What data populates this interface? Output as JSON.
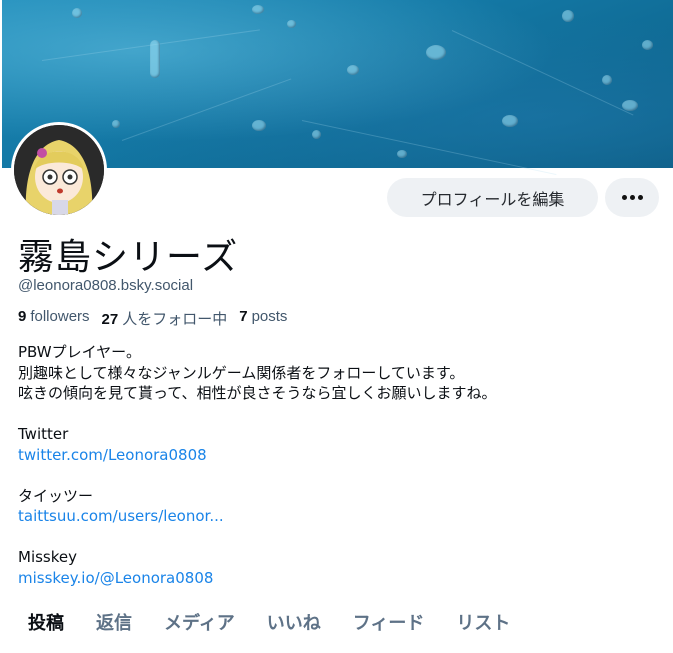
{
  "profile": {
    "display_name": "霧島シリーズ",
    "handle": "@leonora0808.bsky.social",
    "edit_profile_label": "プロフィールを編集",
    "more_icon": "ellipsis-icon",
    "stats": {
      "followers_count": "9",
      "followers_label": "followers",
      "following_count": "27",
      "following_label": "人をフォロー中",
      "posts_count": "7",
      "posts_label": "posts"
    },
    "bio": {
      "line1": "PBWプレイヤー。",
      "line2": "別趣味として様々なジャンルゲーム関係者をフォローしています。",
      "line3": "呟きの傾向を見て貰って、相性が良さそうなら宜しくお願いしますね。",
      "twitter_label": "Twitter",
      "twitter_link": "twitter.com/Leonora0808",
      "taittsuu_label": "タイッツー",
      "taittsuu_link": "taittsuu.com/users/leonor...",
      "misskey_label": "Misskey",
      "misskey_link": "misskey.io/@Leonora0808"
    }
  },
  "tabs": [
    {
      "label": "投稿",
      "active": true
    },
    {
      "label": "返信",
      "active": false
    },
    {
      "label": "メディア",
      "active": false
    },
    {
      "label": "いいね",
      "active": false
    },
    {
      "label": "フィード",
      "active": false
    },
    {
      "label": "リスト",
      "active": false
    }
  ],
  "colors": {
    "link": "#1a84e8",
    "muted_text": "#42576c",
    "button_bg": "#eef1f4"
  }
}
